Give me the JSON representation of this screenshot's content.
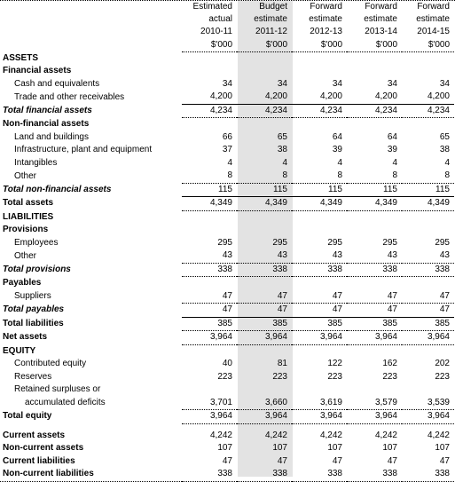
{
  "columns": [
    {
      "line1": "Estimated",
      "line2": "actual",
      "period": "2010-11",
      "unit": "$'000"
    },
    {
      "line1": "Budget",
      "line2": "estimate",
      "period": "2011-12",
      "unit": "$'000"
    },
    {
      "line1": "Forward",
      "line2": "estimate",
      "period": "2012-13",
      "unit": "$'000"
    },
    {
      "line1": "Forward",
      "line2": "estimate",
      "period": "2013-14",
      "unit": "$'000"
    },
    {
      "line1": "Forward",
      "line2": "estimate",
      "period": "2014-15",
      "unit": "$'000"
    }
  ],
  "highlight_color": "#e3e3e3",
  "rows": [
    {
      "label": "ASSETS",
      "style": "bold",
      "values": []
    },
    {
      "label": "Financial assets",
      "style": "bold",
      "values": []
    },
    {
      "label": "Cash and equivalents",
      "style": "ind1",
      "values": [
        "34",
        "34",
        "34",
        "34",
        "34"
      ]
    },
    {
      "label": "Trade and other receivables",
      "style": "ind1",
      "line": "solid",
      "values": [
        "4,200",
        "4,200",
        "4,200",
        "4,200",
        "4,200"
      ]
    },
    {
      "label": "Total financial assets",
      "style": "bi",
      "line": "dot",
      "values": [
        "4,234",
        "4,234",
        "4,234",
        "4,234",
        "4,234"
      ]
    },
    {
      "label": "Non-financial assets",
      "style": "bold",
      "values": []
    },
    {
      "label": "Land and buildings",
      "style": "ind1",
      "values": [
        "66",
        "65",
        "64",
        "64",
        "65"
      ]
    },
    {
      "label": "Infrastructure, plant and equipment",
      "style": "ind1",
      "values": [
        "37",
        "38",
        "39",
        "39",
        "38"
      ]
    },
    {
      "label": "Intangibles",
      "style": "ind1",
      "values": [
        "4",
        "4",
        "4",
        "4",
        "4"
      ]
    },
    {
      "label": "Other",
      "style": "ind1",
      "line": "dot",
      "values": [
        "8",
        "8",
        "8",
        "8",
        "8"
      ]
    },
    {
      "label": "Total non-financial assets",
      "style": "bi",
      "line": "solid",
      "values": [
        "115",
        "115",
        "115",
        "115",
        "115"
      ]
    },
    {
      "label": "Total assets",
      "style": "bold",
      "line": "dot",
      "values": [
        "4,349",
        "4,349",
        "4,349",
        "4,349",
        "4,349"
      ]
    },
    {
      "label": "LIABILITIES",
      "style": "bold",
      "values": []
    },
    {
      "label": "Provisions",
      "style": "bold",
      "values": []
    },
    {
      "label": "Employees",
      "style": "ind1",
      "values": [
        "295",
        "295",
        "295",
        "295",
        "295"
      ]
    },
    {
      "label": "Other",
      "style": "ind1",
      "line": "dot",
      "values": [
        "43",
        "43",
        "43",
        "43",
        "43"
      ]
    },
    {
      "label": "Total provisions",
      "style": "bi",
      "line": "dot",
      "values": [
        "338",
        "338",
        "338",
        "338",
        "338"
      ]
    },
    {
      "label": "Payables",
      "style": "bold",
      "values": []
    },
    {
      "label": "Suppliers",
      "style": "ind1",
      "line": "dot",
      "values": [
        "47",
        "47",
        "47",
        "47",
        "47"
      ]
    },
    {
      "label": "Total payables",
      "style": "bi",
      "line": "solid",
      "values": [
        "47",
        "47",
        "47",
        "47",
        "47"
      ]
    },
    {
      "label": "Total liabilities",
      "style": "bold",
      "line": "dot",
      "values": [
        "385",
        "385",
        "385",
        "385",
        "385"
      ]
    },
    {
      "label": "Net assets",
      "style": "bold",
      "line": "dot",
      "values": [
        "3,964",
        "3,964",
        "3,964",
        "3,964",
        "3,964"
      ]
    },
    {
      "label": "EQUITY",
      "style": "bold",
      "values": []
    },
    {
      "label": "Contributed equity",
      "style": "ind1",
      "values": [
        "40",
        "81",
        "122",
        "162",
        "202"
      ]
    },
    {
      "label": "Reserves",
      "style": "ind1",
      "values": [
        "223",
        "223",
        "223",
        "223",
        "223"
      ]
    },
    {
      "label": "Retained surpluses or",
      "style": "ind1",
      "values": []
    },
    {
      "label": "accumulated deficits",
      "style": "ind2",
      "line": "dot",
      "values": [
        "3,701",
        "3,660",
        "3,619",
        "3,579",
        "3,539"
      ]
    },
    {
      "label": "Total equity",
      "style": "bold",
      "line": "dot",
      "values": [
        "3,964",
        "3,964",
        "3,964",
        "3,964",
        "3,964"
      ]
    },
    {
      "label": "",
      "style": "spacer",
      "values": []
    },
    {
      "label": "Current assets",
      "style": "bold",
      "values": [
        "4,242",
        "4,242",
        "4,242",
        "4,242",
        "4,242"
      ]
    },
    {
      "label": "Non-current assets",
      "style": "bold",
      "values": [
        "107",
        "107",
        "107",
        "107",
        "107"
      ]
    },
    {
      "label": "Current liabilities",
      "style": "bold",
      "values": [
        "47",
        "47",
        "47",
        "47",
        "47"
      ]
    },
    {
      "label": "Non-current liabilities",
      "style": "bold",
      "line": "dotfull",
      "values": [
        "338",
        "338",
        "338",
        "338",
        "338"
      ]
    }
  ]
}
